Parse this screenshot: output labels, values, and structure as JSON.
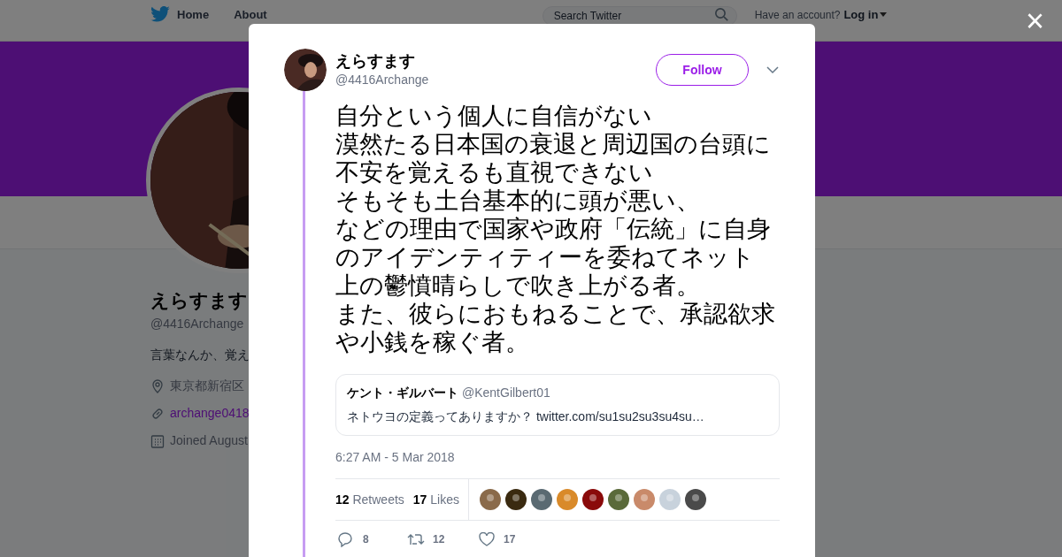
{
  "nav": {
    "items": [
      "Home",
      "About"
    ],
    "search": {
      "placeholder": "Search Twitter"
    },
    "account_prompt": "Have an account?",
    "login": "Log in"
  },
  "profile": {
    "name": "えらすます",
    "handle": "@4416Archange",
    "bio": "言葉なんか、覚え",
    "location": "東京都新宿区",
    "link": "archange0418",
    "joined": "Joined August"
  },
  "close": "×",
  "tweet": {
    "name": "えらすます",
    "handle": "@4416Archange",
    "follow": "Follow",
    "text_lines": [
      "自分という個人に自信がない",
      "漠然たる日本国の衰退と周辺国の台頭に",
      "不安を覚えるも直視できない",
      "そもそも土台基本的に頭が悪い、",
      "などの理由で国家や政府「伝統」に自身",
      "のアイデンティティーを委ねてネット",
      "上の鬱憤晴らしで吹き上がる者。",
      "また、彼らにおもねることで、承認欲求",
      "や小銭を稼ぐ者。"
    ],
    "quote": {
      "name": "ケント・ギルバート",
      "handle": "@KentGilbert01",
      "text": "ネトウヨの定義ってありますか？ twitter.com/su1su2su3su4su…"
    },
    "time": "6:27 AM - 5 Mar 2018",
    "retweets": {
      "count": "12",
      "label": "Retweets"
    },
    "likes": {
      "count": "17",
      "label": "Likes"
    },
    "actions": {
      "replies": "8",
      "retweets": "12",
      "likes": "17"
    }
  }
}
